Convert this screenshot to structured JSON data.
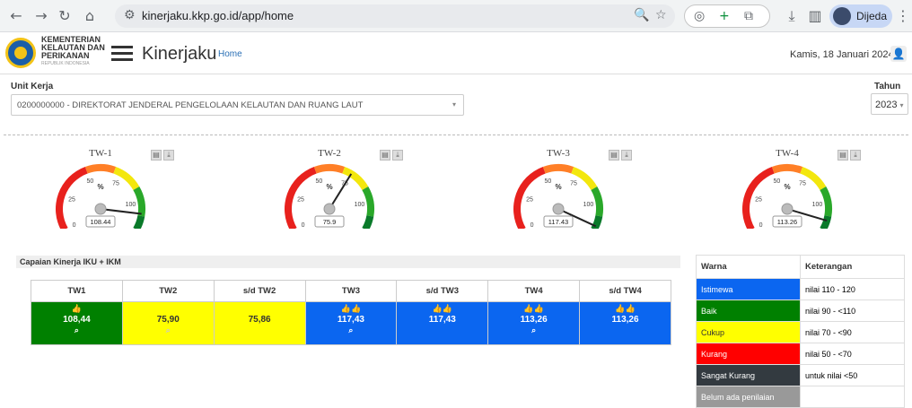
{
  "browser": {
    "url": "kinerjaku.kkp.go.id/app/home",
    "profile_name": "Dijeda"
  },
  "header": {
    "ministry_lines": [
      "KEMENTERIAN",
      "KELAUTAN DAN",
      "PERIKANAN"
    ],
    "ministry_sub": "REPUBLIK INDONESIA",
    "app_title": "Kinerjaku",
    "home_link": "Home",
    "date": "Kamis, 18 Januari 2024"
  },
  "filters": {
    "unit_label": "Unit Kerja",
    "unit_value": "0200000000 - DIREKTORAT JENDERAL PENGELOLAAN KELAUTAN DAN RUANG LAUT",
    "tahun_label": "Tahun",
    "tahun_value": "2023"
  },
  "gauges": [
    {
      "title": "TW-1",
      "value": 108.44,
      "label": "108.44"
    },
    {
      "title": "TW-2",
      "value": 75.9,
      "label": "75.9"
    },
    {
      "title": "TW-3",
      "value": 117.43,
      "label": "117.43"
    },
    {
      "title": "TW-4",
      "value": 113.26,
      "label": "113.26"
    }
  ],
  "gauge_scale": {
    "min": 0,
    "max": 120,
    "ticks": [
      "0",
      "25",
      "50",
      "75",
      "100"
    ],
    "unit": "%"
  },
  "capaian": {
    "title": "Capaian Kinerja IKU + IKM",
    "headers": [
      "TW1",
      "TW2",
      "s/d TW2",
      "TW3",
      "s/d TW3",
      "TW4",
      "s/d TW4"
    ],
    "cells": [
      {
        "value": "108,44",
        "color": "green",
        "thumbs": "👍",
        "search": true
      },
      {
        "value": "75,90",
        "color": "yellow",
        "thumbs": "",
        "search": true
      },
      {
        "value": "75,86",
        "color": "yellow",
        "thumbs": "",
        "search": false
      },
      {
        "value": "117,43",
        "color": "blue",
        "thumbs": "👍👍",
        "search": true
      },
      {
        "value": "117,43",
        "color": "blue",
        "thumbs": "👍👍",
        "search": false
      },
      {
        "value": "113,26",
        "color": "blue",
        "thumbs": "👍👍",
        "search": true
      },
      {
        "value": "113,26",
        "color": "blue",
        "thumbs": "👍👍",
        "search": false
      }
    ]
  },
  "legend": {
    "headers": [
      "Warna",
      "Keterangan"
    ],
    "rows": [
      {
        "name": "Istimewa",
        "desc": "nilai 110 - 120",
        "color": "#0b66f0"
      },
      {
        "name": "Baik",
        "desc": "nilai 90 - <110",
        "color": "#008000"
      },
      {
        "name": "Cukup",
        "desc": "nilai 70 - <90",
        "color": "#ffff00"
      },
      {
        "name": "Kurang",
        "desc": "nilai 50 - <70",
        "color": "#ff0000"
      },
      {
        "name": "Sangat Kurang",
        "desc": "untuk nilai <50",
        "color": "#333a40"
      },
      {
        "name": "Belum ada penilaian",
        "desc": "",
        "color": "#999999"
      }
    ]
  }
}
